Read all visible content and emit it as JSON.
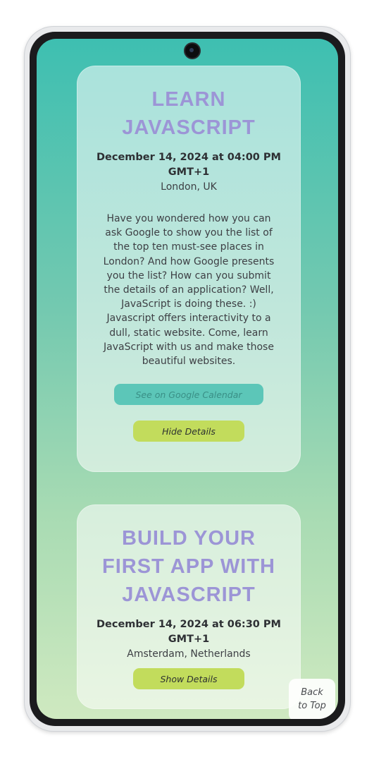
{
  "events": [
    {
      "title": "LEARN\nJAVASCRIPT",
      "datetime": "December 14, 2024 at 04:00 PM GMT+1",
      "location": "London, UK",
      "description": "Have you wondered how you can ask Google to show you the list of the top ten must-see places in London? And how Google presents you the list? How can you submit the details of an application? Well, JavaScript is doing these. :) Javascript offers interactivity to a dull, static website. Come, learn JavaScript with us and make those beautiful websites.",
      "calendar_label": "See on Google Calendar",
      "details_label": "Hide Details"
    },
    {
      "title": "BUILD YOUR\nFIRST APP WITH\nJAVASCRIPT",
      "datetime": "December 14, 2024 at 06:30 PM GMT+1",
      "location": "Amsterdam, Netherlands",
      "details_label": "Show Details"
    }
  ],
  "back_to_top_label": "Back\nto Top",
  "colors": {
    "title": "#9c95d6",
    "calendar_button": "#5cc6b8",
    "details_button": "#c2dc5c",
    "gradient_top": "#3ebfb1",
    "gradient_bottom": "#cfe9c0"
  },
  "icons": {
    "camera": "front-camera-icon"
  }
}
